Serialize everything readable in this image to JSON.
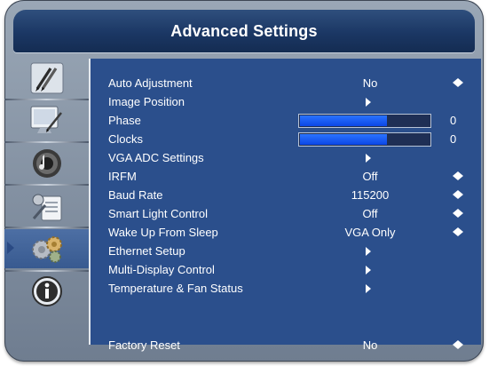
{
  "title": "Advanced Settings",
  "sidebar": {
    "items": [
      {
        "icon": "pens-icon"
      },
      {
        "icon": "monitor-icon"
      },
      {
        "icon": "speaker-icon"
      },
      {
        "icon": "tools-document-icon"
      },
      {
        "icon": "gears-icon",
        "selected": true
      },
      {
        "icon": "info-icon"
      }
    ]
  },
  "menu": {
    "auto_adjustment": {
      "label": "Auto Adjustment",
      "value": "No"
    },
    "image_position": {
      "label": "Image Position"
    },
    "phase": {
      "label": "Phase",
      "value": "0",
      "level": 0.67
    },
    "clocks": {
      "label": "Clocks",
      "value": "0",
      "level": 0.67
    },
    "vga_adc": {
      "label": "VGA ADC Settings"
    },
    "irfm": {
      "label": "IRFM",
      "value": "Off"
    },
    "baud_rate": {
      "label": "Baud Rate",
      "value": "115200"
    },
    "smart_light": {
      "label": "Smart Light Control",
      "value": "Off"
    },
    "wake_up": {
      "label": "Wake Up From Sleep",
      "value": "VGA Only"
    },
    "ethernet": {
      "label": "Ethernet Setup"
    },
    "multi_display": {
      "label": "Multi-Display Control"
    },
    "temperature": {
      "label": "Temperature & Fan Status"
    },
    "factory_reset": {
      "label": "Factory Reset",
      "value": "No"
    }
  },
  "colors": {
    "panel": "#2b4f8c",
    "title_bar": "#1b3764",
    "bar_fill": "#0b46e6",
    "frame": "#8a97a8"
  }
}
